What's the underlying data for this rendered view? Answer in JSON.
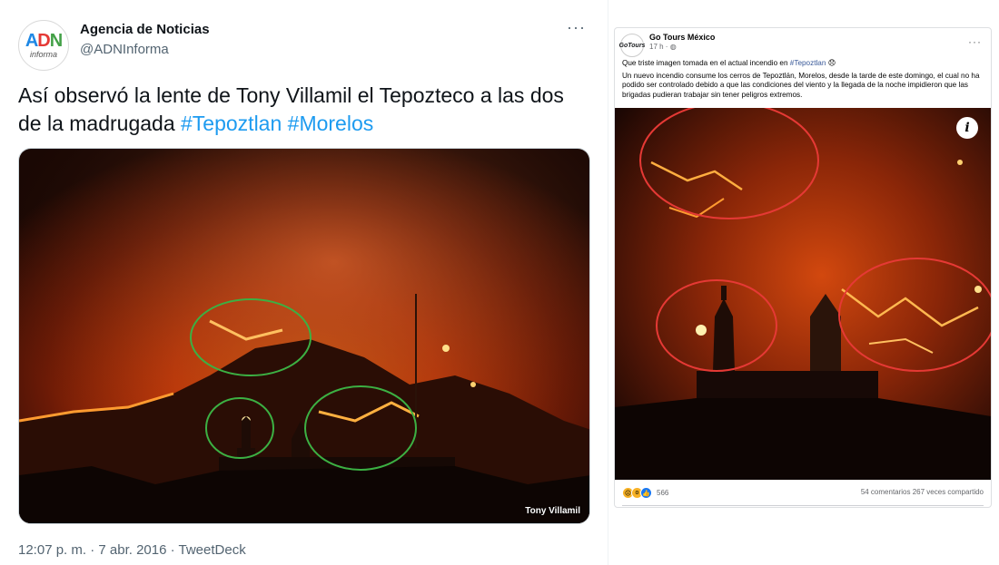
{
  "tweet": {
    "author_name": "Agencia de Noticias",
    "handle": "@ADNInforma",
    "avatar_logo": {
      "a": "A",
      "d": "D",
      "n": "N",
      "sub": "informa"
    },
    "more_label": "···",
    "text_plain": "Así observó la lente de Tony Villamil el Tepozteco a las dos de la madrugada ",
    "hashtag_1": "#Tepoztlan",
    "hashtag_2": "#Morelos",
    "photo_credit": "Tony Villamil",
    "timestamp": "12:07 p. m. · 7 abr. 2016 · TweetDeck",
    "annotation_color": "#3cb043"
  },
  "facebook_post": {
    "page_name": "Go Tours México",
    "avatar_text": "GoTours",
    "time": "17 h · ",
    "more_label": "···",
    "caption_line1_prefix": "Que triste imagen tomada en el actual incendio en ",
    "caption_line1_hashtag": "#Tepoztlan",
    "caption_line1_emoji": "😞",
    "caption_body": "Un nuevo incendio consume los cerros de Tepoztlán, Morelos, desde la tarde de este domingo, el cual no ha podido ser controlado debido a que las condiciones del viento y la llegada de la noche impidieron que las brigadas pudieran trabajar sin tener peligros extremos.",
    "info_label": "i",
    "reaction_icons": [
      "sad",
      "wow",
      "like"
    ],
    "reaction_count": "566",
    "stats": "54 comentarios  267 veces compartido",
    "annotation_color": "#e53935"
  }
}
